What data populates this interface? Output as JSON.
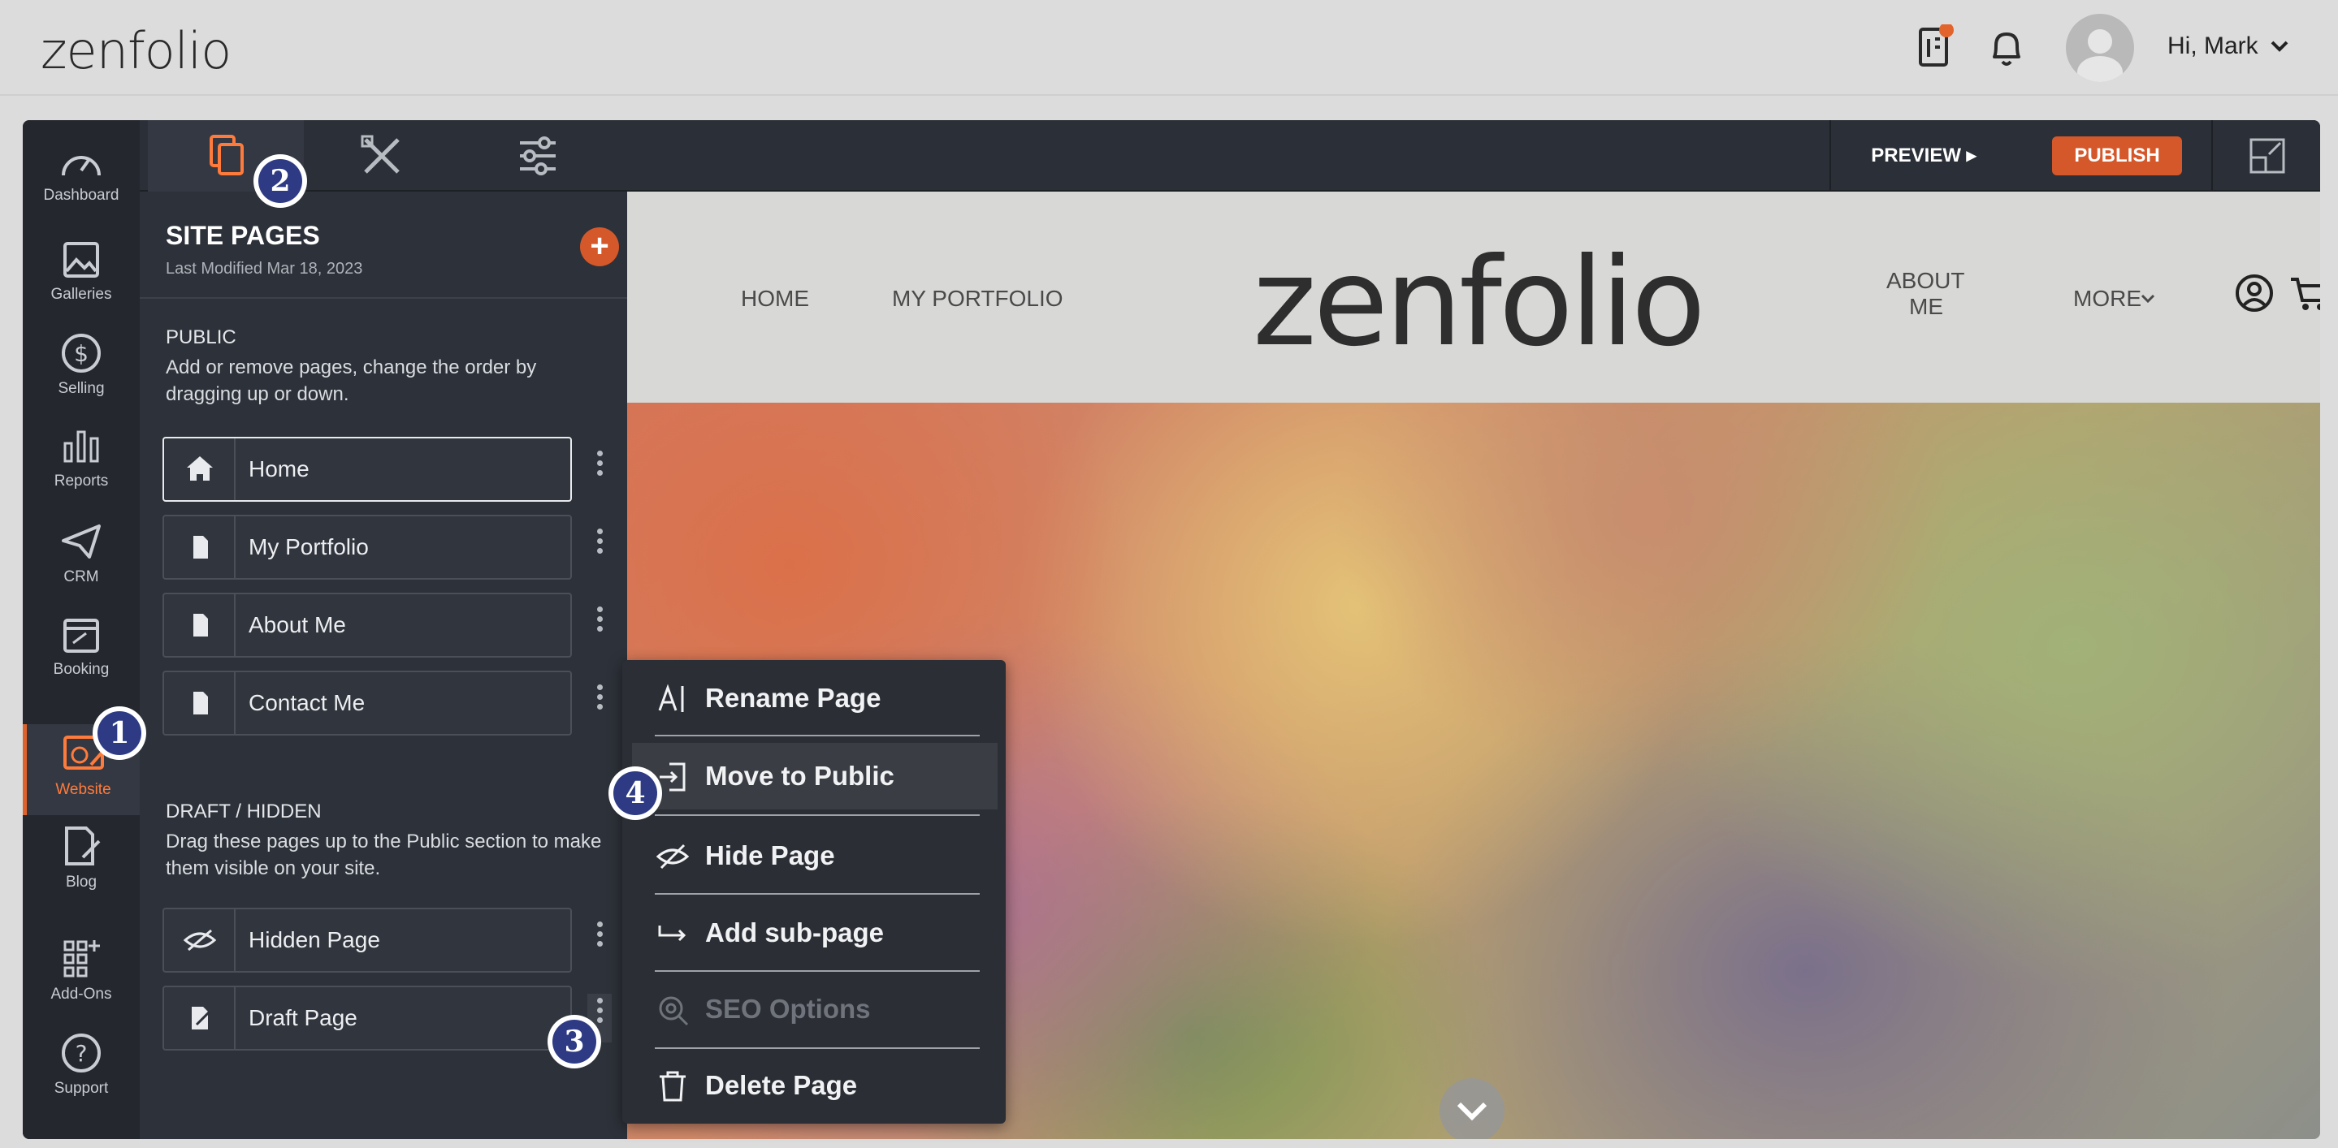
{
  "topbar": {
    "brand": "zenfolio",
    "greeting": "Hi, Mark"
  },
  "rail": {
    "items": [
      {
        "label": "Dashboard",
        "icon": "dashboard-icon"
      },
      {
        "label": "Galleries",
        "icon": "galleries-icon"
      },
      {
        "label": "Selling",
        "icon": "dollar-icon"
      },
      {
        "label": "Reports",
        "icon": "bar-chart-icon"
      },
      {
        "label": "CRM",
        "icon": "paper-plane-icon"
      },
      {
        "label": "Booking",
        "icon": "calendar-icon"
      },
      {
        "label": "Website",
        "icon": "website-icon",
        "active": true
      },
      {
        "label": "Blog",
        "icon": "blog-icon"
      },
      {
        "label": "Add-Ons",
        "icon": "grid-plus-icon"
      },
      {
        "label": "Support",
        "icon": "help-icon"
      }
    ]
  },
  "editor": {
    "preview_label": "PREVIEW ▸",
    "publish_label": "PUBLISH"
  },
  "panel": {
    "title": "SITE PAGES",
    "last_modified": "Last Modified Mar 18, 2023",
    "public": {
      "heading": "PUBLIC",
      "description": "Add or remove pages, change the order by dragging up or down.",
      "pages": [
        {
          "label": "Home",
          "icon": "home-icon"
        },
        {
          "label": "My Portfolio",
          "icon": "page-icon"
        },
        {
          "label": "About Me",
          "icon": "page-icon"
        },
        {
          "label": "Contact Me",
          "icon": "page-icon"
        }
      ]
    },
    "draft": {
      "heading": "DRAFT / HIDDEN",
      "description": "Drag these pages up to the Public section to make them visible on your site.",
      "pages": [
        {
          "label": "Hidden Page",
          "icon": "eye-off-icon"
        },
        {
          "label": "Draft Page",
          "icon": "draft-icon"
        }
      ]
    }
  },
  "site": {
    "nav": {
      "home": "HOME",
      "portfolio": "MY PORTFOLIO",
      "about_line1": "ABOUT",
      "about_line2": "ME",
      "more": "MORE"
    },
    "logo": "zenfolio"
  },
  "context_menu": {
    "items": [
      {
        "label": "Rename Page",
        "icon": "rename-icon"
      },
      {
        "label": "Move to Public",
        "icon": "move-in-icon"
      },
      {
        "label": "Hide Page",
        "icon": "eye-off-icon"
      },
      {
        "label": "Add sub-page",
        "icon": "sub-page-arrow-icon"
      },
      {
        "label": "SEO Options",
        "icon": "seo-icon",
        "disabled": true
      },
      {
        "label": "Delete Page",
        "icon": "trash-icon"
      }
    ]
  },
  "callouts": [
    "1",
    "2",
    "3",
    "4"
  ],
  "colors": {
    "accent": "#d5582a",
    "rail_bg": "#24272d",
    "panel_bg": "#2d3139",
    "callout": "#2e3b84"
  }
}
